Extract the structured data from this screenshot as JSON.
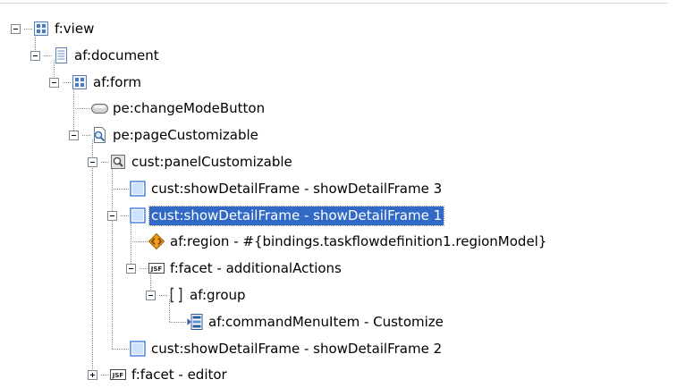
{
  "colors": {
    "selection_background": "#3169c6",
    "selection_text": "#ffffff"
  },
  "tree": {
    "nodes": [
      {
        "id": "f-view",
        "icon": "panel-grid-icon",
        "label": "f:view",
        "toggle": "collapse",
        "level": 0
      },
      {
        "id": "af-document",
        "icon": "document-icon",
        "label": "af:document",
        "toggle": "collapse",
        "level": 1
      },
      {
        "id": "af-form",
        "icon": "panel-grid-icon",
        "label": "af:form",
        "toggle": "collapse",
        "level": 2
      },
      {
        "id": "pe-changemodebutton",
        "icon": "button-icon",
        "label": "pe:changeModeButton",
        "toggle": "none",
        "level": 3
      },
      {
        "id": "pe-pagecustomizable",
        "icon": "page-customizable-icon",
        "label": "pe:pageCustomizable",
        "toggle": "collapse",
        "level": 3
      },
      {
        "id": "cust-panelcustomizable",
        "icon": "panel-customizable-icon",
        "label": "cust:panelCustomizable",
        "toggle": "collapse",
        "level": 4
      },
      {
        "id": "showdetailframe-3",
        "icon": "frame-icon",
        "label": "cust:showDetailFrame - showDetailFrame 3",
        "toggle": "none",
        "level": 5
      },
      {
        "id": "showdetailframe-1",
        "icon": "frame-icon",
        "label": "cust:showDetailFrame - showDetailFrame 1",
        "toggle": "collapse",
        "level": 5,
        "selected": true
      },
      {
        "id": "af-region",
        "icon": "region-icon",
        "label": "af:region - #{bindings.taskflowdefinition1.regionModel}",
        "toggle": "none",
        "level": 6
      },
      {
        "id": "facet-additionalactions",
        "icon": "jsf-icon",
        "icon_text": "JSF",
        "label": "f:facet - additionalActions",
        "toggle": "collapse",
        "level": 6
      },
      {
        "id": "af-group",
        "icon": "group-brackets-icon",
        "label": "af:group",
        "toggle": "collapse",
        "level": 7
      },
      {
        "id": "af-commandmenuitem",
        "icon": "menu-item-icon",
        "label": "af:commandMenuItem - Customize",
        "toggle": "none",
        "level": 8
      },
      {
        "id": "showdetailframe-2",
        "icon": "frame-icon",
        "label": "cust:showDetailFrame - showDetailFrame 2",
        "toggle": "none",
        "level": 5
      },
      {
        "id": "facet-editor",
        "icon": "jsf-icon",
        "icon_text": "JSF",
        "label": "f:facet - editor",
        "toggle": "expand",
        "level": 4
      }
    ]
  }
}
